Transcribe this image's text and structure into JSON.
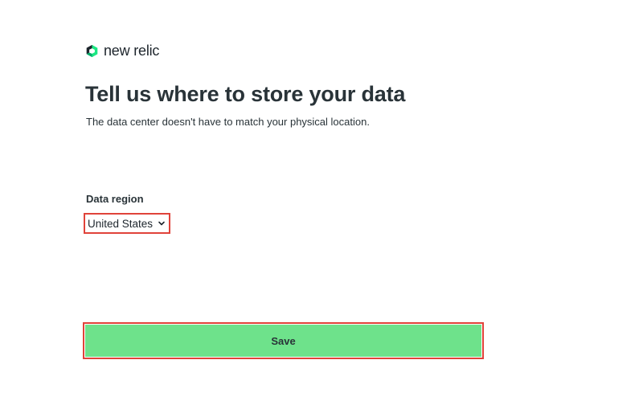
{
  "brand": {
    "name": "new relic",
    "icon": "new-relic-logo-icon",
    "color": "#1ce783"
  },
  "heading": {
    "title": "Tell us where to store your data",
    "subtitle": "The data center doesn't have to match your physical location."
  },
  "form": {
    "region_label": "Data region",
    "region_value": "United States",
    "region_icon": "chevron-down-icon",
    "save_label": "Save"
  },
  "colors": {
    "save_button": "#6ee28b",
    "highlight_outline": "#e0433a",
    "text": "#293338"
  }
}
